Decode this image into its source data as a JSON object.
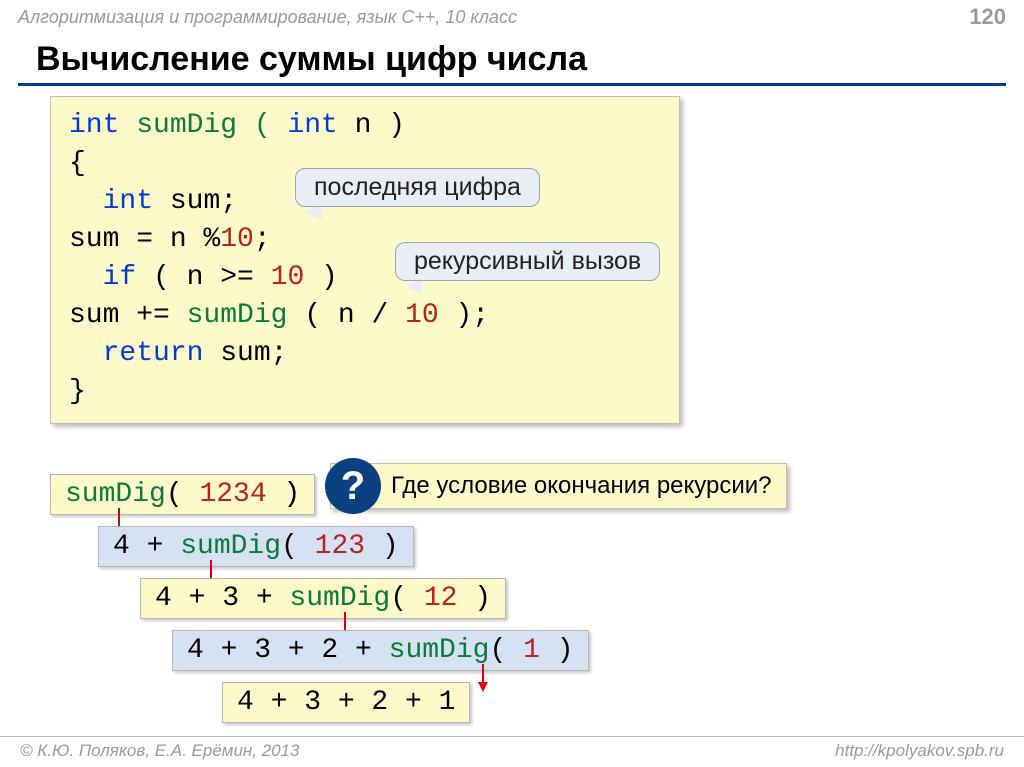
{
  "header": {
    "course": "Алгоритмизация и программирование, язык  C++, 10 класс",
    "page": "120"
  },
  "title": "Вычисление суммы цифр числа",
  "code": {
    "l1a": "int",
    "l1b": " sumDig ( ",
    "l1c": "int",
    "l1d": " n )",
    "l2": "{",
    "l3a": "int",
    "l3b": " sum;",
    "l4a": "  sum = n %",
    "l4b": "10",
    "l4c": ";",
    "l5a": "if",
    "l5b": " ( n >= ",
    "l5c": "10",
    "l5d": " )",
    "l6a": "   sum += ",
    "l6b": "sumDig",
    "l6c": " ( n / ",
    "l6d": "10",
    "l6e": " );",
    "l7a": "return",
    "l7b": " sum;",
    "l8": "}"
  },
  "callouts": {
    "lastDigit": "последняя цифра",
    "recursive": "рекурсивный вызов",
    "question": "Где условие окончания рекурсии?",
    "qm": "?"
  },
  "steps": {
    "s1a": "sumDig",
    "s1b": "(",
    "s1c": " 1234 ",
    "s1d": ")",
    "s2a": "4 + ",
    "s2b": "sumDig",
    "s2c": "(",
    "s2d": " 123 ",
    "s2e": ")",
    "s3a": "4 + 3 + ",
    "s3b": "sumDig",
    "s3c": "(",
    "s3d": " 12 ",
    "s3e": ")",
    "s4a": "4 + 3 + 2 + ",
    "s4b": "sumDig",
    "s4c": "(",
    "s4d": " 1 ",
    "s4e": ")",
    "s5": "4 + 3 + 2 + 1"
  },
  "footer": {
    "left": "© К.Ю. Поляков, Е.А. Ерёмин, 2013",
    "right": "http://kpolyakov.spb.ru"
  }
}
